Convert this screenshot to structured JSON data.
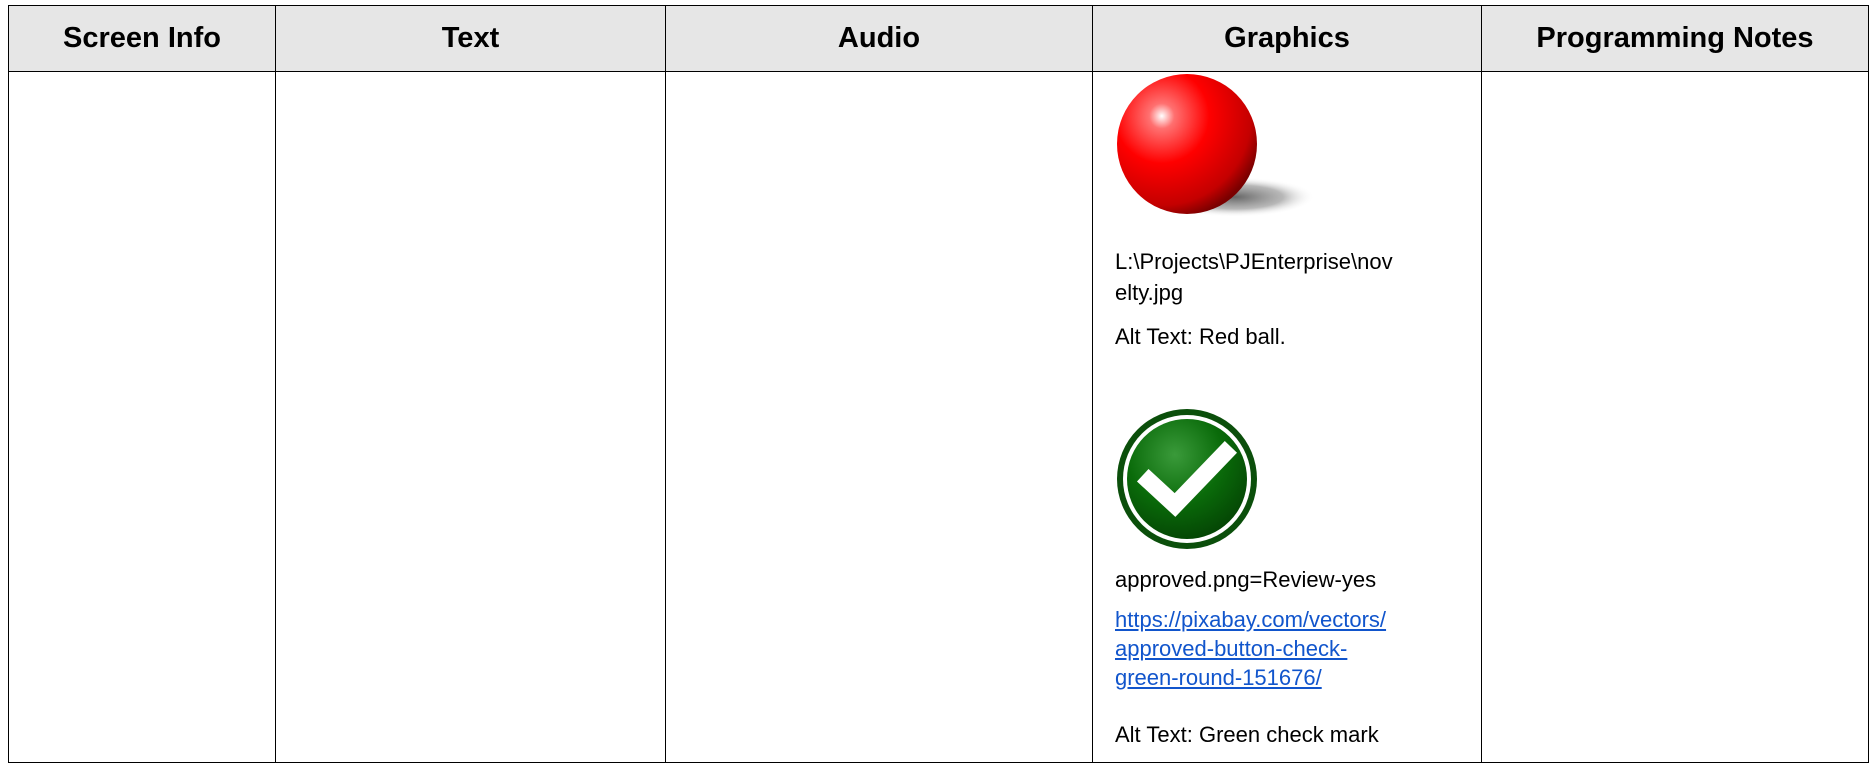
{
  "headers": {
    "screen_info": "Screen Info",
    "text": "Text",
    "audio": "Audio",
    "graphics": "Graphics",
    "programming_notes": "Programming Notes"
  },
  "graphics": {
    "image1": {
      "icon": "red-ball",
      "path_line1": "L:\\Projects\\PJEnterprise\\nov",
      "path_line2": "elty.jpg",
      "alt_text": "Alt Text: Red ball."
    },
    "image2": {
      "icon": "green-check-mark",
      "filename": "approved.png=Review-yes",
      "link_line1": "https://pixabay.com/vectors/",
      "link_line2": "approved-button-check-",
      "link_line3": "green-round-151676/",
      "alt_text": "Alt Text: Green check mark"
    }
  },
  "colors": {
    "header_bg": "#e6e6e6",
    "border": "#000000",
    "link": "#1155cc",
    "ball": "#ff0000",
    "check_bg": "#0a6b0a"
  }
}
